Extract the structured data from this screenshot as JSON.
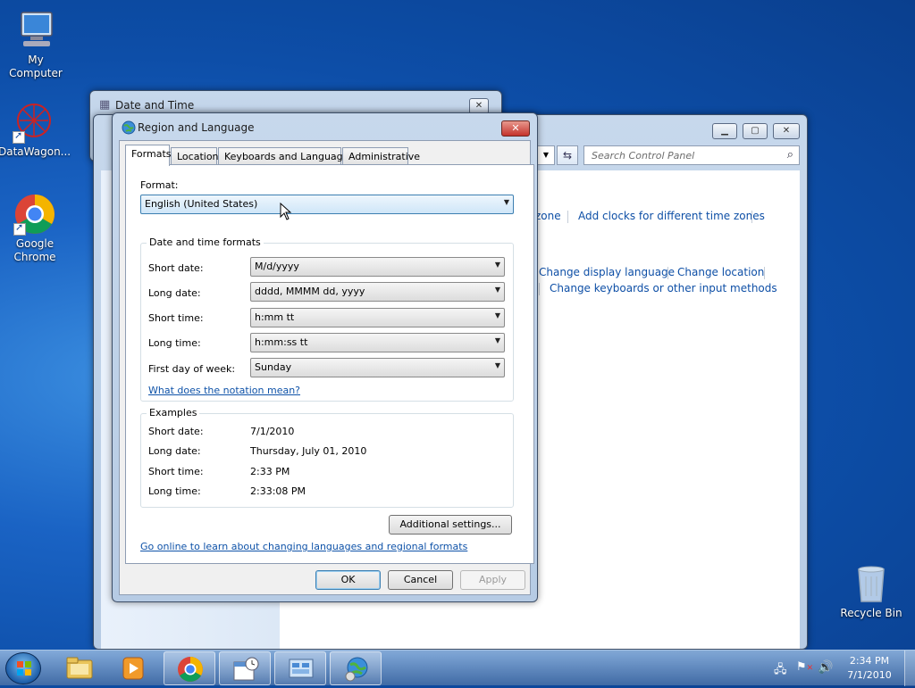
{
  "desktop": {
    "icons": [
      {
        "label": "My Computer",
        "icon": "computer-icon"
      },
      {
        "label": "DataWagon...",
        "icon": "datawagon-icon"
      },
      {
        "label": "Google Chrome",
        "icon": "chrome-icon"
      },
      {
        "label": "Recycle Bin",
        "icon": "recycle-bin-icon"
      }
    ]
  },
  "date_time_window": {
    "title": "Date and Time"
  },
  "control_panel": {
    "search_placeholder": "Search Control Panel",
    "links": {
      "zone": "zone",
      "add_clocks": "Add clocks for different time zones",
      "change_display_language": "Change display language",
      "change_location": "Change location",
      "change_keyboards": "Change keyboards or other input methods"
    }
  },
  "dialog": {
    "title": "Region and Language",
    "tabs": [
      "Formats",
      "Location",
      "Keyboards and Languages",
      "Administrative"
    ],
    "format_label": "Format:",
    "format_value": "English (United States)",
    "dt_group_title": "Date and time formats",
    "fields": [
      {
        "label": "Short date:",
        "value": "M/d/yyyy"
      },
      {
        "label": "Long date:",
        "value": "dddd, MMMM dd, yyyy"
      },
      {
        "label": "Short time:",
        "value": "h:mm tt"
      },
      {
        "label": "Long time:",
        "value": "h:mm:ss tt"
      },
      {
        "label": "First day of week:",
        "value": "Sunday"
      }
    ],
    "notation_link": "What does the notation mean?",
    "examples_title": "Examples",
    "examples": [
      {
        "label": "Short date:",
        "value": "7/1/2010"
      },
      {
        "label": "Long date:",
        "value": "Thursday, July 01, 2010"
      },
      {
        "label": "Short time:",
        "value": "2:33 PM"
      },
      {
        "label": "Long time:",
        "value": "2:33:08 PM"
      }
    ],
    "additional_settings": "Additional settings...",
    "online_link": "Go online to learn about changing languages and regional formats",
    "ok": "OK",
    "cancel": "Cancel",
    "apply": "Apply"
  },
  "taskbar": {
    "time": "2:34 PM",
    "date": "7/1/2010"
  },
  "colors": {
    "link": "#0e52a8",
    "accent": "#3c7fb1",
    "close_red": "#c4332c"
  }
}
